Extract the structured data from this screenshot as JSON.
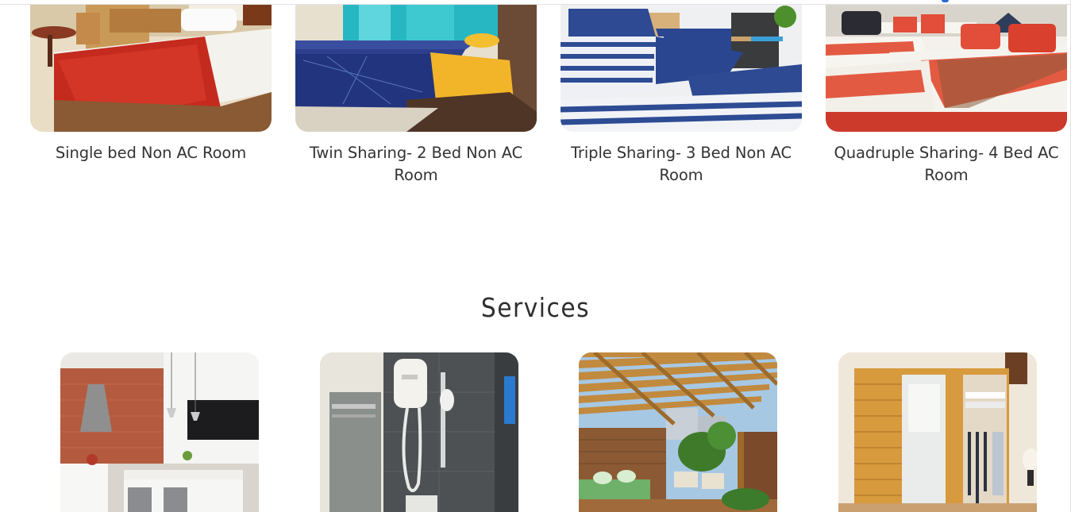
{
  "rooms": [
    {
      "label": "Single bed Non AC Room",
      "image": "single-bed-room-photo"
    },
    {
      "label": "Twin Sharing- 2 Bed Non AC Room",
      "image": "twin-sharing-room-photo"
    },
    {
      "label": "Triple Sharing- 3 Bed Non AC Room",
      "image": "triple-sharing-room-photo"
    },
    {
      "label": "Quadruple Sharing- 4 Bed AC Room",
      "image": "quadruple-sharing-room-photo"
    }
  ],
  "services": {
    "title": "Services",
    "items": [
      {
        "image": "kitchen-photo"
      },
      {
        "image": "water-heater-shower-photo"
      },
      {
        "image": "rooftop-terrace-photo"
      },
      {
        "image": "wardrobe-photo"
      }
    ]
  },
  "colors": {
    "accent": "#2b69d6",
    "text": "#333333"
  }
}
